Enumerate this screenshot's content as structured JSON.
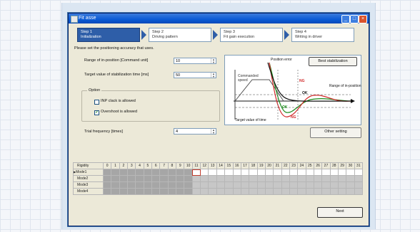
{
  "window": {
    "title": "Fit asse"
  },
  "steps": [
    {
      "line1": "Step 1",
      "line2": "Initialization"
    },
    {
      "line1": "Step 2",
      "line2": "Driving pattern"
    },
    {
      "line1": "Step 3",
      "line2": "Fit gain execution"
    },
    {
      "line1": "Step 4",
      "line2": "Writing in driver"
    }
  ],
  "instruction": "Please set the positioning accuracy that uses.",
  "fields": {
    "range_label": "Range of in-position [Command unit]",
    "range_value": "10",
    "stab_label": "Target value of stabilization time [ms]",
    "stab_value": "50",
    "trial_label": "Trial frequency [times]",
    "trial_value": "4"
  },
  "option": {
    "title": "Option",
    "inp_label": "INP clack is allowed",
    "overshoot_label": "Overshoot is allowed",
    "overshoot_check": "✔"
  },
  "diagram": {
    "best_button": "Best stabilization",
    "position_error": "Position error",
    "commanded_speed": "Commanded speed",
    "range_in_position": "Range of in-position",
    "target_value": "Target value of time",
    "ng": "NG",
    "ok": "OK"
  },
  "other_setting_button": "Other setting",
  "next_button": "Next",
  "table": {
    "header_label": "Rigidity",
    "columns": [
      "0",
      "1",
      "2",
      "3",
      "4",
      "5",
      "6",
      "7",
      "8",
      "9",
      "10",
      "11",
      "12",
      "13",
      "14",
      "15",
      "16",
      "17",
      "18",
      "19",
      "20",
      "21",
      "22",
      "23",
      "24",
      "25",
      "26",
      "27",
      "28",
      "29",
      "30",
      "31"
    ],
    "rows": [
      "Mode1",
      "Mode2",
      "Mode3",
      "Mode4"
    ],
    "row_marker": "▶"
  },
  "colors": {
    "title_bar": "#0a5bd6",
    "active_step": "#2e5ea8",
    "grid_gray": "#a6a6a6",
    "selection": "#c13b2b"
  }
}
